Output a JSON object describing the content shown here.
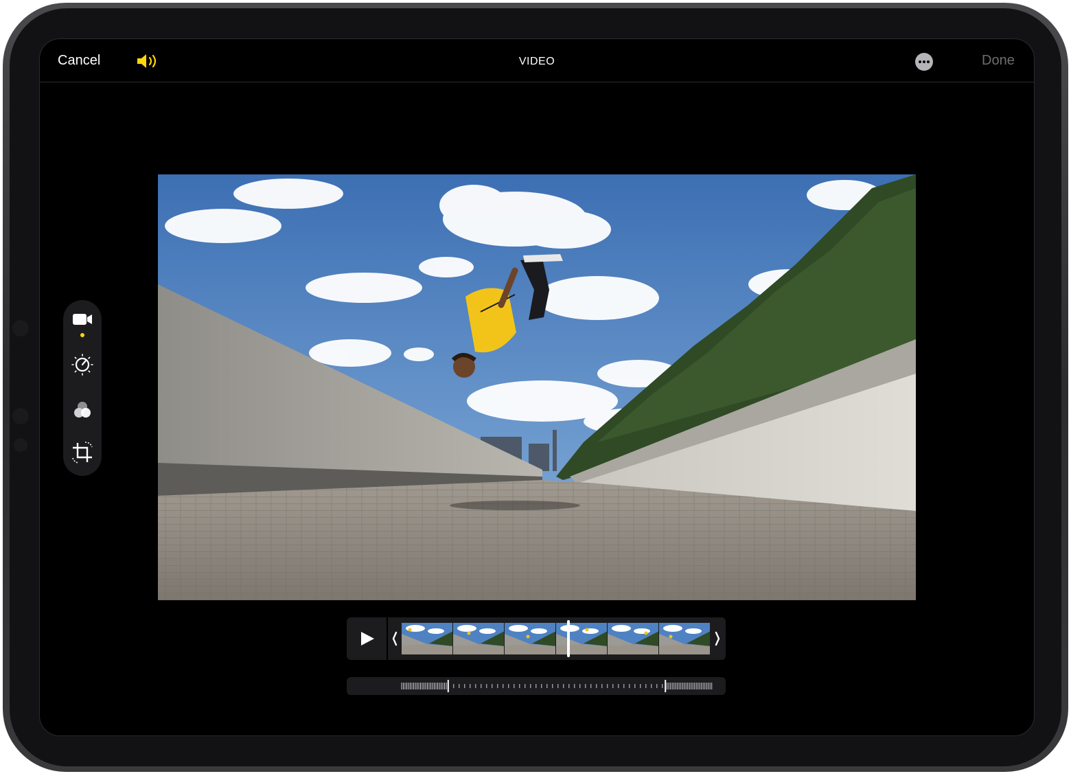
{
  "topbar": {
    "cancel_label": "Cancel",
    "title": "VIDEO",
    "done_label": "Done",
    "accent_color": "#ffd60a",
    "sound_icon": "speaker-on-icon",
    "more_icon": "ellipsis-circle-icon"
  },
  "tools": {
    "items": [
      {
        "name": "video",
        "icon": "video-camera-icon",
        "active": true
      },
      {
        "name": "adjust",
        "icon": "adjust-dial-icon",
        "active": false
      },
      {
        "name": "filters",
        "icon": "filters-circles-icon",
        "active": false
      },
      {
        "name": "crop",
        "icon": "crop-rotate-icon",
        "active": false
      }
    ]
  },
  "timeline": {
    "frame_count": 6,
    "play_icon": "play-icon",
    "playhead_fraction": 0.54
  },
  "scrubber": {
    "marker_left_fraction": 0.15,
    "marker_right_fraction": 0.85
  }
}
